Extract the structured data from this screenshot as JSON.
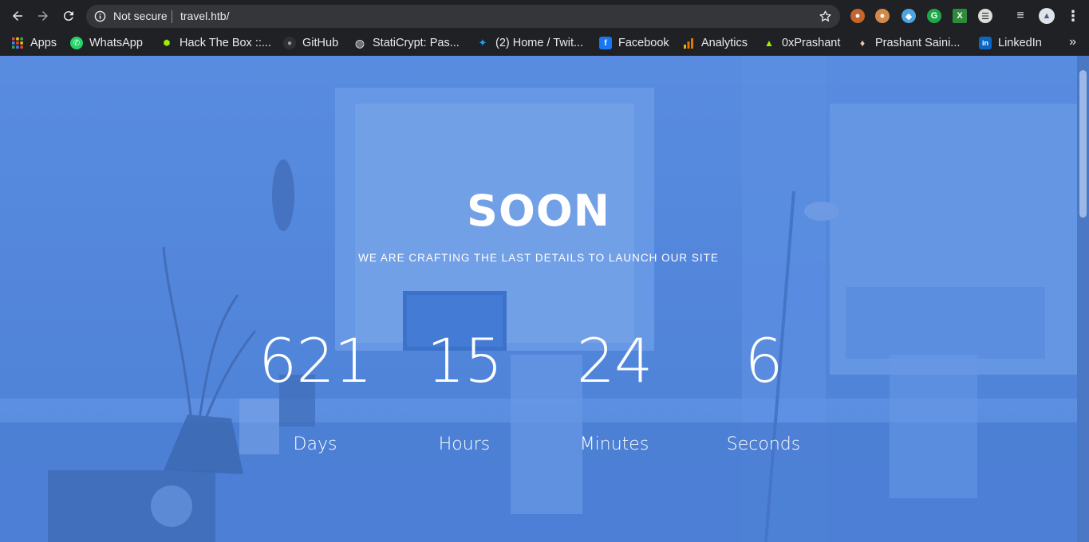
{
  "browser": {
    "security_label": "Not secure",
    "url": "travel.htb/"
  },
  "bookmarks": [
    {
      "label": "Apps",
      "icon": "apps-grid-icon"
    },
    {
      "label": "WhatsApp",
      "icon": "whatsapp-icon"
    },
    {
      "label": "Hack The Box ::...",
      "icon": "hackthebox-icon"
    },
    {
      "label": "GitHub",
      "icon": "github-icon"
    },
    {
      "label": "StatiCrypt: Pas...",
      "icon": "globe-icon"
    },
    {
      "label": "(2) Home / Twit...",
      "icon": "twitter-icon"
    },
    {
      "label": "Facebook",
      "icon": "facebook-icon"
    },
    {
      "label": "Analytics",
      "icon": "analytics-icon"
    },
    {
      "label": "0xPrashant",
      "icon": "hackthebox-icon"
    },
    {
      "label": "Prashant Saini...",
      "icon": "profile-icon"
    },
    {
      "label": "LinkedIn",
      "icon": "linkedin-icon"
    }
  ],
  "page": {
    "title": "SOON",
    "subtitle": "WE ARE CRAFTING THE LAST DETAILS TO LAUNCH OUR SITE",
    "countdown": [
      {
        "value": "621",
        "label": "Days"
      },
      {
        "value": "15",
        "label": "Hours"
      },
      {
        "value": "24",
        "label": "Minutes"
      },
      {
        "value": "6",
        "label": "Seconds"
      }
    ]
  },
  "colors": {
    "overlay": "#4a82dc",
    "chrome_bg": "#202124",
    "omnibox_bg": "#35363a"
  }
}
